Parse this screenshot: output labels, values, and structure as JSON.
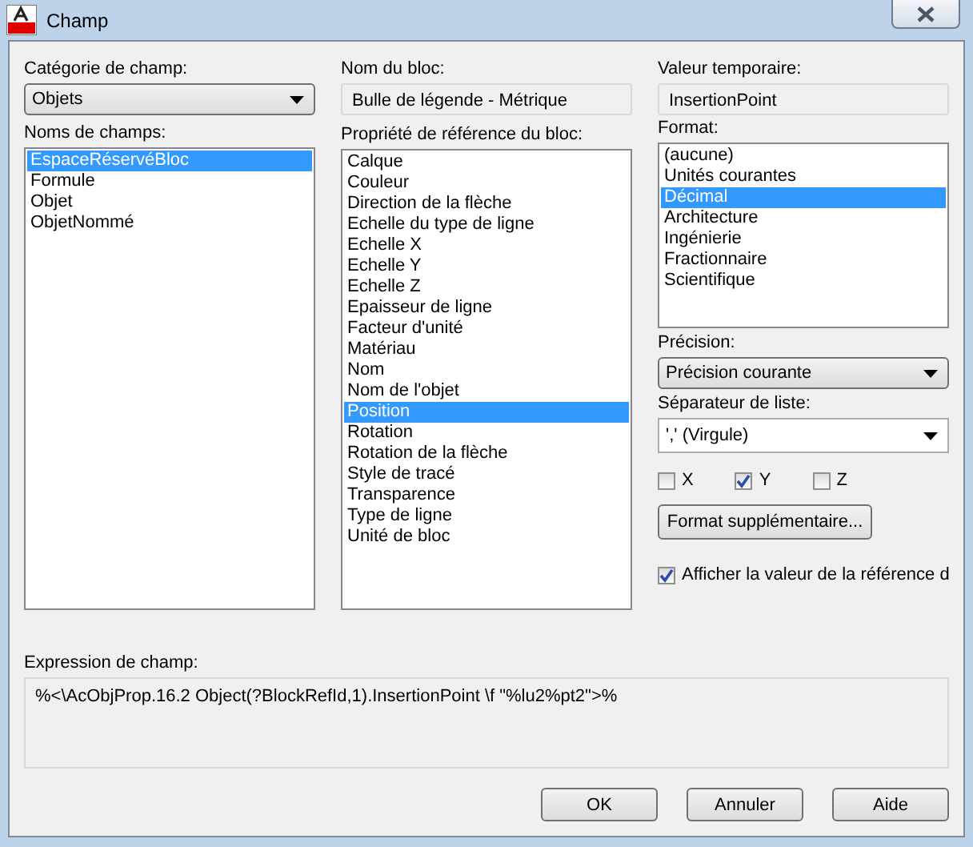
{
  "window": {
    "title": "Champ"
  },
  "category": {
    "label": "Catégorie de champ:",
    "value": "Objets"
  },
  "field_names": {
    "label": "Noms de champs:",
    "items": [
      {
        "label": "EspaceRéservéBloc",
        "selected": true
      },
      {
        "label": "Formule",
        "selected": false
      },
      {
        "label": "Objet",
        "selected": false
      },
      {
        "label": "ObjetNommé",
        "selected": false
      }
    ]
  },
  "block_name": {
    "label": "Nom du bloc:",
    "value": "Bulle de légende - Métrique"
  },
  "block_property": {
    "label": "Propriété de référence du bloc:",
    "items": [
      {
        "label": "Calque",
        "selected": false
      },
      {
        "label": "Couleur",
        "selected": false
      },
      {
        "label": "Direction de la flèche",
        "selected": false
      },
      {
        "label": "Echelle du type de ligne",
        "selected": false
      },
      {
        "label": "Echelle X",
        "selected": false
      },
      {
        "label": "Echelle Y",
        "selected": false
      },
      {
        "label": "Echelle Z",
        "selected": false
      },
      {
        "label": "Epaisseur de ligne",
        "selected": false
      },
      {
        "label": "Facteur d'unité",
        "selected": false
      },
      {
        "label": "Matériau",
        "selected": false
      },
      {
        "label": "Nom",
        "selected": false
      },
      {
        "label": "Nom de l'objet",
        "selected": false
      },
      {
        "label": "Position",
        "selected": true
      },
      {
        "label": "Rotation",
        "selected": false
      },
      {
        "label": "Rotation de la flèche",
        "selected": false
      },
      {
        "label": "Style de tracé",
        "selected": false
      },
      {
        "label": "Transparence",
        "selected": false
      },
      {
        "label": "Type de ligne",
        "selected": false
      },
      {
        "label": "Unité de bloc",
        "selected": false
      }
    ]
  },
  "temp_value": {
    "label": "Valeur temporaire:",
    "value": "InsertionPoint"
  },
  "format": {
    "label": "Format:",
    "items": [
      {
        "label": "(aucune)",
        "selected": false
      },
      {
        "label": "Unités courantes",
        "selected": false
      },
      {
        "label": "Décimal",
        "selected": true
      },
      {
        "label": "Architecture",
        "selected": false
      },
      {
        "label": "Ingénierie",
        "selected": false
      },
      {
        "label": "Fractionnaire",
        "selected": false
      },
      {
        "label": "Scientifique",
        "selected": false
      }
    ]
  },
  "precision": {
    "label": "Précision:",
    "value": "Précision courante"
  },
  "separator": {
    "label": "Séparateur de liste:",
    "value": "',' (Virgule)"
  },
  "axes": [
    {
      "label": "X",
      "checked": false
    },
    {
      "label": "Y",
      "checked": true
    },
    {
      "label": "Z",
      "checked": false
    }
  ],
  "extra_format_button": "Format supplémentaire...",
  "show_value": {
    "label": "Afficher la valeur de la référence d",
    "checked": true
  },
  "expression": {
    "label": "Expression de champ:",
    "value": "%<\\AcObjProp.16.2 Object(?BlockRefId,1).InsertionPoint \\f \"%lu2%pt2\">%"
  },
  "buttons": [
    "OK",
    "Annuler",
    "Aide"
  ]
}
